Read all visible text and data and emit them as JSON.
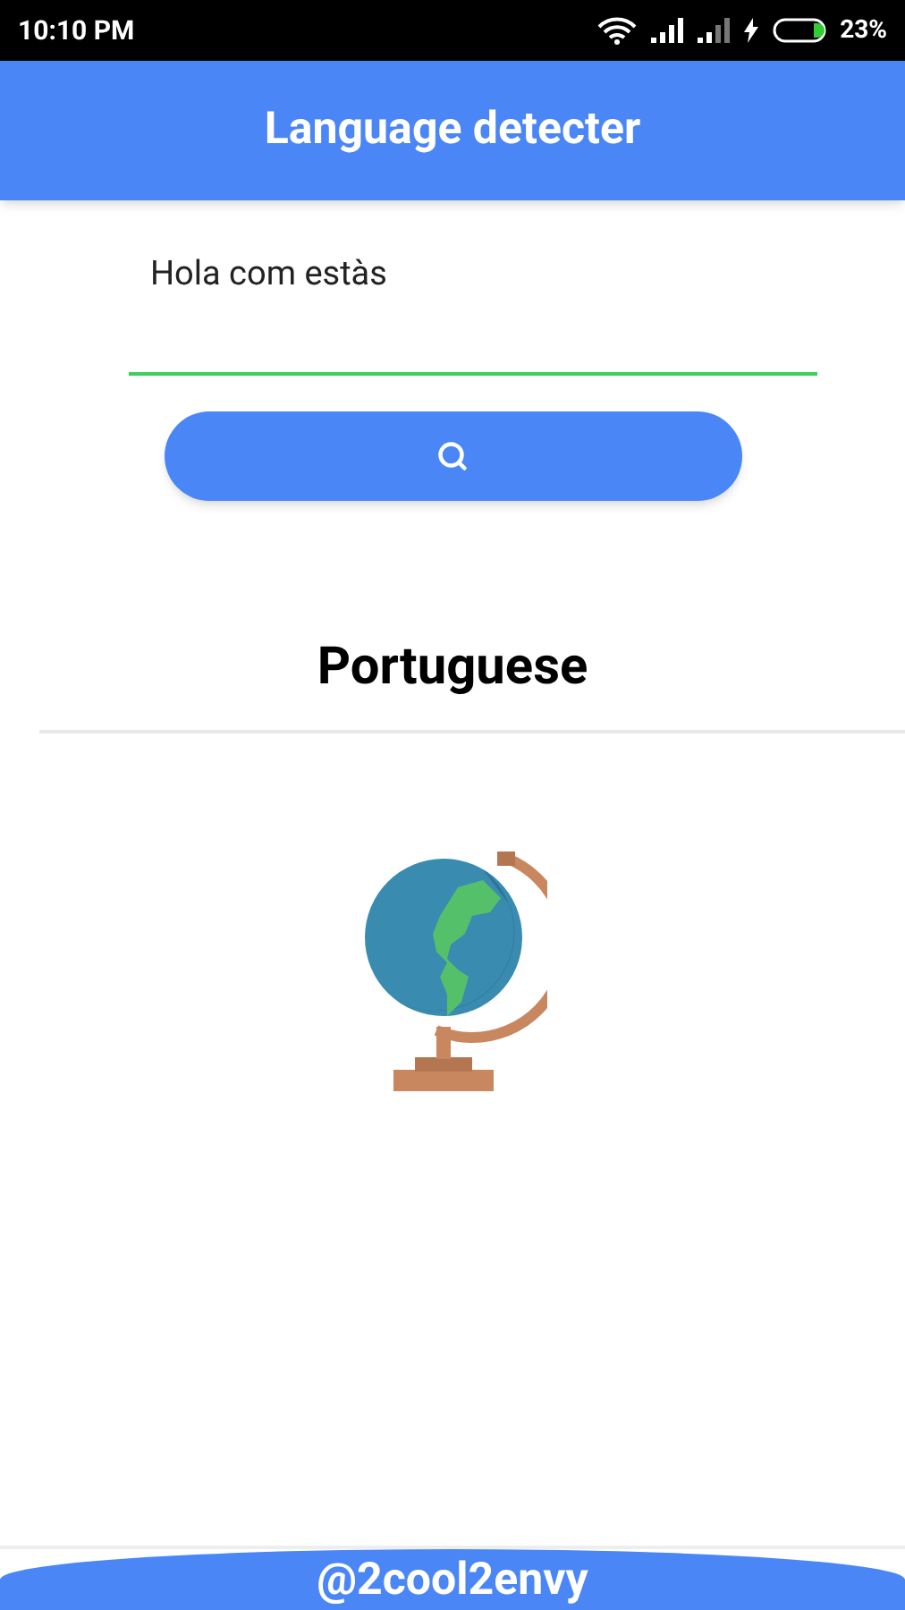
{
  "status_bar": {
    "time": "10:10 PM",
    "battery": "23%"
  },
  "app_bar": {
    "title": "Language detecter"
  },
  "input": {
    "value": "Hola com estàs"
  },
  "result": {
    "language": "Portuguese"
  },
  "footer": {
    "text": "@2cool2envy"
  }
}
